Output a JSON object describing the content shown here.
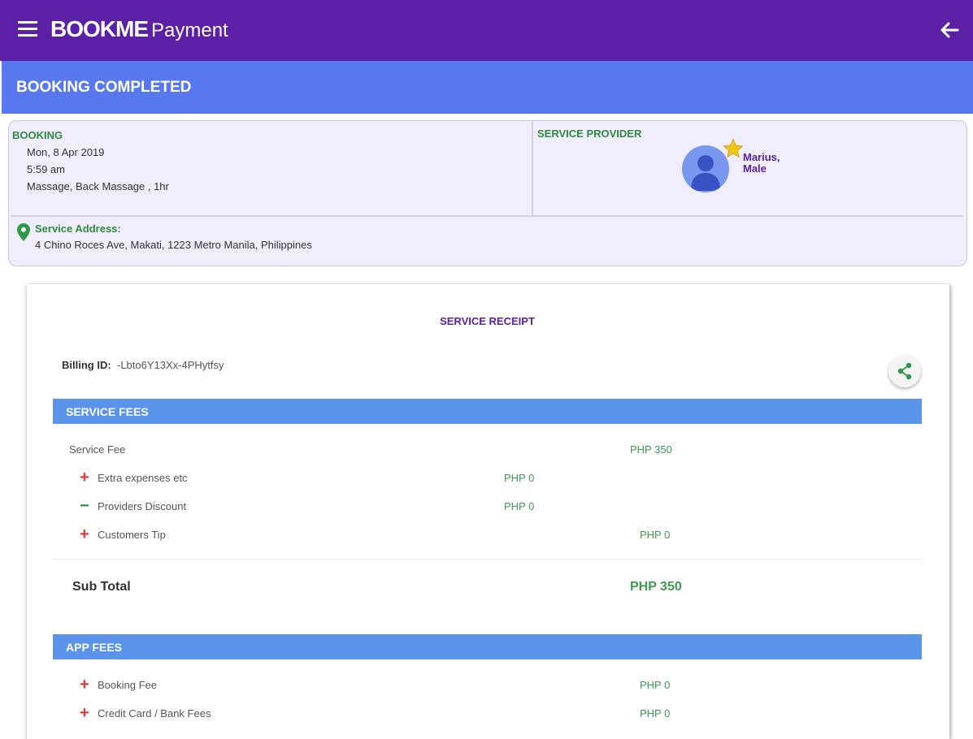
{
  "header": {
    "brand": "BOOKME",
    "title": "Payment",
    "color": "#5b20a6"
  },
  "status": {
    "text": "BOOKING COMPLETED",
    "color": "#5878f0"
  },
  "booking": {
    "label": "BOOKING",
    "date": "Mon, 8 Apr 2019",
    "time": "5:59 am",
    "service": "Massage, Back Massage , 1hr"
  },
  "provider": {
    "label": "SERVICE PROVIDER",
    "name_line1": "Marius,",
    "name_line2": "Male"
  },
  "address": {
    "label": "Service Address:",
    "value": "4 Chino Roces Ave, Makati, 1223 Metro Manila, Philippines"
  },
  "receipt": {
    "title": "SERVICE RECEIPT",
    "billing_label": "Billing ID:",
    "billing_id": "-Lbto6Y13Xx-4PHytfsy",
    "service_fees": {
      "heading": "SERVICE FEES",
      "service_fee_label": "Service Fee",
      "service_fee_amount": "PHP 350",
      "items": [
        {
          "sign": "+",
          "label": "Extra expenses etc",
          "amount": "PHP 0"
        },
        {
          "sign": "−",
          "label": "Providers Discount",
          "amount": "PHP 0"
        },
        {
          "sign": "+",
          "label": "Customers Tip",
          "amount": "PHP 0"
        }
      ]
    },
    "subtotal": {
      "label": "Sub Total",
      "amount": "PHP 350"
    },
    "app_fees": {
      "heading": "APP FEES",
      "items": [
        {
          "sign": "+",
          "label": "Booking Fee",
          "amount": "PHP 0"
        },
        {
          "sign": "+",
          "label": "Credit Card / Bank Fees",
          "amount": "PHP 0"
        }
      ]
    }
  },
  "colors": {
    "plus": "#d83a3a",
    "minus": "#2e8a3c",
    "amount": "#3d9a52",
    "section_head": "#5a93ea"
  }
}
